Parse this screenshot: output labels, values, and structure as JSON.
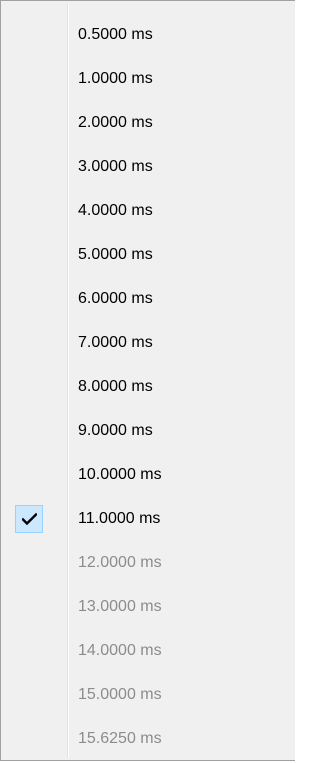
{
  "menu": {
    "items": [
      {
        "label": "0.5000 ms",
        "checked": false,
        "enabled": true
      },
      {
        "label": "1.0000 ms",
        "checked": false,
        "enabled": true
      },
      {
        "label": "2.0000 ms",
        "checked": false,
        "enabled": true
      },
      {
        "label": "3.0000 ms",
        "checked": false,
        "enabled": true
      },
      {
        "label": "4.0000 ms",
        "checked": false,
        "enabled": true
      },
      {
        "label": "5.0000 ms",
        "checked": false,
        "enabled": true
      },
      {
        "label": "6.0000 ms",
        "checked": false,
        "enabled": true
      },
      {
        "label": "7.0000 ms",
        "checked": false,
        "enabled": true
      },
      {
        "label": "8.0000 ms",
        "checked": false,
        "enabled": true
      },
      {
        "label": "9.0000 ms",
        "checked": false,
        "enabled": true
      },
      {
        "label": "10.0000 ms",
        "checked": false,
        "enabled": true
      },
      {
        "label": "11.0000 ms",
        "checked": true,
        "enabled": true
      },
      {
        "label": "12.0000 ms",
        "checked": false,
        "enabled": false
      },
      {
        "label": "13.0000 ms",
        "checked": false,
        "enabled": false
      },
      {
        "label": "14.0000 ms",
        "checked": false,
        "enabled": false
      },
      {
        "label": "15.0000 ms",
        "checked": false,
        "enabled": false
      },
      {
        "label": "15.6250 ms",
        "checked": false,
        "enabled": false
      }
    ],
    "check_icon": "checkmark-icon",
    "colors": {
      "background": "#f0f0f0",
      "border": "#a0a0a0",
      "text": "#000000",
      "disabled_text": "#8c8c8c",
      "check_highlight": "#cce8ff",
      "check_highlight_border": "#99d1ff"
    }
  }
}
